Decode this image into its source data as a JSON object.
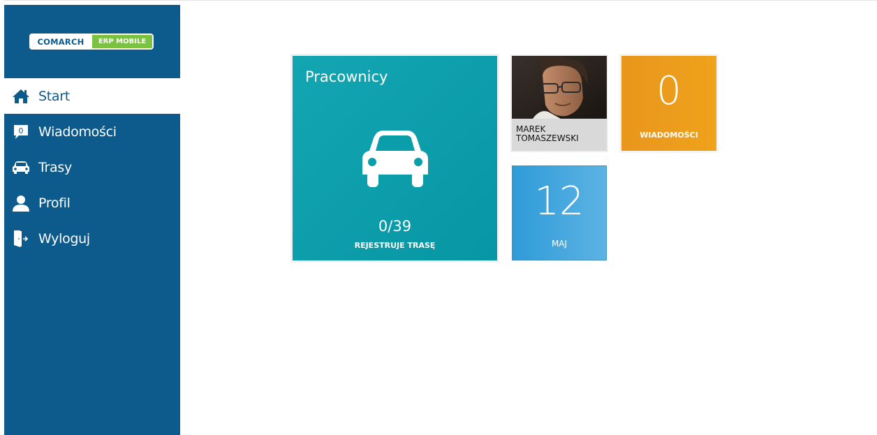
{
  "logo": {
    "brand": "COMARCH",
    "product": "ERP MOBILE"
  },
  "colors": {
    "sidebar": "#0d5a8c",
    "tile_teal": "#0aa0ad",
    "tile_orange": "#f0a21b",
    "tile_blue": "#3aa4dd"
  },
  "sidebar": {
    "items": [
      {
        "label": "Start",
        "icon": "home-icon",
        "active": true
      },
      {
        "label": "Wiadomości",
        "icon": "message-icon",
        "badge": "0"
      },
      {
        "label": "Trasy",
        "icon": "car-icon"
      },
      {
        "label": "Profil",
        "icon": "user-icon"
      },
      {
        "label": "Wyloguj",
        "icon": "logout-door-icon"
      }
    ]
  },
  "tiles": {
    "pracownicy": {
      "title": "Pracownicy",
      "icon": "car-icon",
      "count": "0/39",
      "caption": "REJESTRUJE TRASĘ"
    },
    "profile": {
      "name_line1": "MAREK",
      "name_line2": "TOMASZEWSKI"
    },
    "wiadomosci": {
      "value": "0",
      "caption": "WIADOMOŚCI"
    },
    "date": {
      "day": "12",
      "month": "MAJ"
    }
  }
}
